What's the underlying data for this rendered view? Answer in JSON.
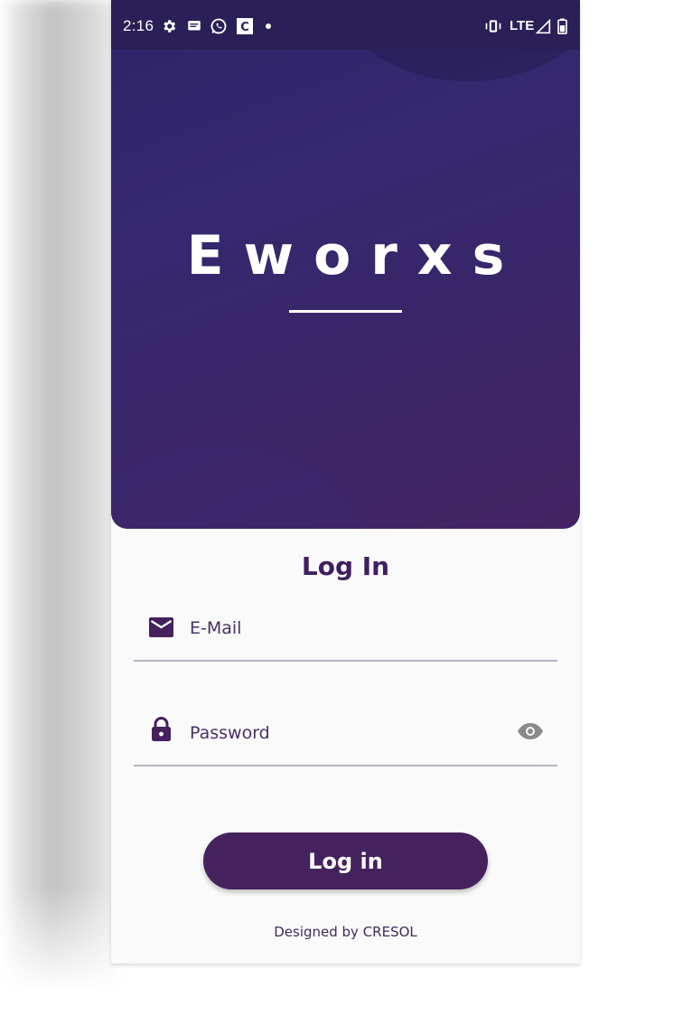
{
  "status_bar": {
    "time": "2:16",
    "icons": [
      "gear-icon",
      "message-icon",
      "whatsapp-icon",
      "c-app-icon",
      "dot-icon"
    ],
    "right_icons": [
      "vibrate-icon",
      "signal-icon",
      "battery-icon"
    ],
    "network": "LTE"
  },
  "hero": {
    "brand": "Eworxs"
  },
  "login": {
    "title": "Log In",
    "email_placeholder": "E-Mail",
    "password_placeholder": "Password",
    "submit_label": "Log in"
  },
  "footer": {
    "credit": "Designed by CRESOL"
  },
  "colors": {
    "hero": "#35286f",
    "status_bar": "#2b1f57",
    "primary": "#45215e",
    "title": "#3f1f60",
    "background": "#fafafa"
  }
}
